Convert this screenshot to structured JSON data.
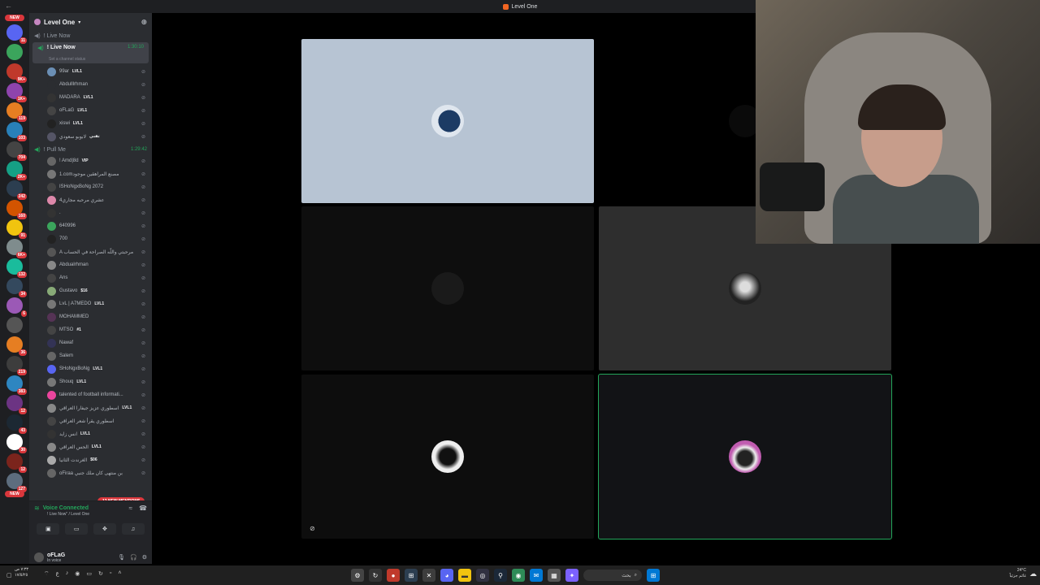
{
  "window": {
    "title": "Level One",
    "accent": "#f26522"
  },
  "rail": {
    "servers": [
      {
        "color": "#5865f2",
        "badge": "11"
      },
      {
        "color": "#3ba55c",
        "badge": ""
      },
      {
        "color": "#c0392b",
        "badge": "9K+"
      },
      {
        "color": "#8e44ad",
        "badge": "1K+"
      },
      {
        "color": "#e67e22",
        "badge": "119"
      },
      {
        "color": "#2980b9",
        "badge": "103"
      },
      {
        "color": "#444",
        "badge": "704"
      },
      {
        "color": "#16a085",
        "badge": "2K+"
      },
      {
        "color": "#2c3e50",
        "badge": "242"
      },
      {
        "color": "#d35400",
        "badge": "160"
      },
      {
        "color": "#f1c40f",
        "badge": "91"
      },
      {
        "color": "#7f8c8d",
        "badge": "6K+"
      },
      {
        "color": "#1abc9c",
        "badge": "132"
      },
      {
        "color": "#34495e",
        "badge": "34"
      },
      {
        "color": "#9b59b6",
        "badge": "6"
      },
      {
        "color": "#555",
        "badge": ""
      },
      {
        "color": "#e67e22",
        "badge": "36"
      },
      {
        "color": "#3d3d3d",
        "badge": "219"
      },
      {
        "color": "#2e86c1",
        "badge": "383"
      },
      {
        "color": "#6c3483",
        "badge": "12"
      },
      {
        "color": "#1c2833",
        "badge": "43"
      },
      {
        "color": "#ffffff",
        "badge": "30"
      },
      {
        "color": "#7b241c",
        "badge": "12"
      },
      {
        "color": "#5d6d7e",
        "badge": "127"
      }
    ],
    "new_top": "NEW",
    "new_bottom": "NEW"
  },
  "sidebar": {
    "guild_name": "Level One",
    "channels": {
      "live_now_muted": "! Live Now",
      "live_now": "! Live Now",
      "live_now_time": "1:30:10",
      "status_placeholder": "Set a channel status",
      "pull_me": "! Pull Me",
      "pull_me_time": "1:29:42"
    },
    "live_users": [
      {
        "name": "99ar",
        "tag": "LVL1",
        "color": "#6b8fb5"
      },
      {
        "name": "Abdulllrhman",
        "tag": "",
        "color": "#2b2d31"
      },
      {
        "name": "MADARA",
        "tag": "LVL1",
        "color": "#333"
      },
      {
        "name": "oFLaG",
        "tag": "LVL1",
        "color": "#444"
      },
      {
        "name": "xiswi",
        "tag": "LVL1",
        "color": "#222"
      },
      {
        "name": "لابوبو سعودي",
        "tag": "تقني",
        "color": "#556"
      }
    ],
    "pull_users": [
      {
        "name": "! Amd|8d",
        "tag": "VIP",
        "color": "#666"
      },
      {
        "name": "1.comمصنع المراهقين موجود",
        "tag": "",
        "color": "#777"
      },
      {
        "name": "ISHoNgxBoNg 2072",
        "tag": "",
        "color": "#444"
      },
      {
        "name": "عشري مرحبه مجاري4",
        "tag": "",
        "color": "#d8a"
      },
      {
        "name": ".",
        "tag": "",
        "color": "#333"
      },
      {
        "name": "640996",
        "tag": "",
        "color": "#3ba55c"
      },
      {
        "name": "700",
        "tag": "",
        "color": "#222"
      },
      {
        "name": "A مرحبتي واللّه الصراحة في الحساب",
        "tag": "",
        "color": "#555"
      },
      {
        "name": "Abdualrhman",
        "tag": "",
        "color": "#888"
      },
      {
        "name": "Ans",
        "tag": "",
        "color": "#444"
      },
      {
        "name": "Gustavo",
        "tag": "$16",
        "color": "#8a7"
      },
      {
        "name": "LvL | A7MEDO",
        "tag": "LVL1",
        "color": "#777"
      },
      {
        "name": "MOHAMMED",
        "tag": "",
        "color": "#535"
      },
      {
        "name": "MTSO",
        "tag": "#1",
        "color": "#444"
      },
      {
        "name": "Nawaf",
        "tag": "",
        "color": "#335"
      },
      {
        "name": "Salem",
        "tag": "",
        "color": "#666"
      },
      {
        "name": "SHoNgxBoNg",
        "tag": "LVL1",
        "color": "#5865f2"
      },
      {
        "name": "Shouq",
        "tag": "LVL1",
        "color": "#777"
      },
      {
        "name": "talented of football informati...",
        "tag": "",
        "color": "#eb459e"
      },
      {
        "name": "اسطوري عزيز جيفارا العراقي",
        "tag": "LVL1",
        "color": "#888"
      },
      {
        "name": "اسطوري يقرأ شعر العراقي",
        "tag": "",
        "color": "#444"
      },
      {
        "name": "انس زايد",
        "tag": "LVL1",
        "color": "#333"
      },
      {
        "name": "الحس العراقي",
        "tag": "LVL1",
        "color": "#888"
      },
      {
        "name": "الغرندت الثانيا",
        "tag": "$06",
        "color": "#aaa"
      },
      {
        "name": "oFiraa بن منتهى كان ملك جنبي",
        "tag": "",
        "color": "#666"
      }
    ],
    "new_mentions": "12 NEW MENTIONS"
  },
  "voice": {
    "status": "Voice Connected",
    "location": "! Live Now\" / Level One"
  },
  "user_panel": {
    "name": "oFLaG",
    "status": "In voice"
  },
  "taskbar": {
    "search_placeholder": "بحث",
    "clock_time": "٧:٣٣ ص",
    "clock_date": "١٧/٥/٢٥",
    "weather_temp": "24°C",
    "weather_desc": "غائم جزئياً"
  }
}
